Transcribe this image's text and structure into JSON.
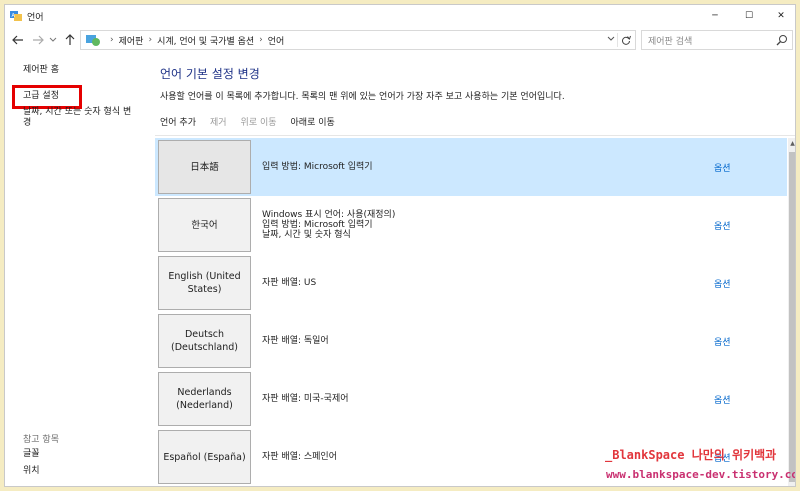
{
  "window": {
    "title": "언어",
    "min_glyph": "─",
    "max_glyph": "☐",
    "close_glyph": "✕"
  },
  "address": {
    "crumbs": [
      "제어판",
      "시계, 언어 및 국가별 옵션",
      "언어"
    ],
    "search_placeholder": "제어판 검색"
  },
  "sidebar": {
    "home": "제어판 홈",
    "advanced": "고급 설정",
    "datetime_line1": "날짜, 시간 또는 숫자 형식 변",
    "datetime_line2": "경",
    "see_also": "참고 항목",
    "fonts": "글꼴",
    "location": "위치"
  },
  "main": {
    "heading": "언어 기본 설정 변경",
    "description": "사용할 언어를 이 목록에 추가합니다. 목록의 맨 위에 있는 언어가 가장 자주 보고 사용하는 기본 언어입니다.",
    "toolbar": {
      "add": "언어 추가",
      "remove": "제거",
      "move_up": "위로 이동",
      "move_down": "아래로 이동"
    },
    "languages": [
      {
        "name": "日本語",
        "info": [
          "입력 방법: Microsoft 입력기"
        ],
        "option": "옵션",
        "selected": true
      },
      {
        "name": "한국어",
        "info": [
          "Windows 표시 언어: 사용(재정의)",
          "입력 방법: Microsoft 입력기",
          "날짜, 시간 및 숫자 형식"
        ],
        "option": "옵션",
        "selected": false
      },
      {
        "name": "English (United States)",
        "info": [
          "자판 배열: US"
        ],
        "option": "옵션",
        "selected": false
      },
      {
        "name": "Deutsch (Deutschland)",
        "info": [
          "자판 배열: 독일어"
        ],
        "option": "옵션",
        "selected": false
      },
      {
        "name": "Nederlands (Nederland)",
        "info": [
          "자판 배열: 미국-국제어"
        ],
        "option": "옵션",
        "selected": false
      },
      {
        "name": "Español (España)",
        "info": [
          "자판 배열: 스페인어"
        ],
        "option": "옵션",
        "selected": false
      }
    ]
  },
  "watermark": {
    "line1": "_BlankSpace 나만의 위키백과",
    "line2": "www.blankspace-dev.tistory.com"
  },
  "colors": {
    "accent_heading": "#1e3287",
    "link": "#0066cc",
    "selection": "#cce8ff",
    "highlight_box": "#e50000",
    "background_frame": "#f5ecc2"
  }
}
